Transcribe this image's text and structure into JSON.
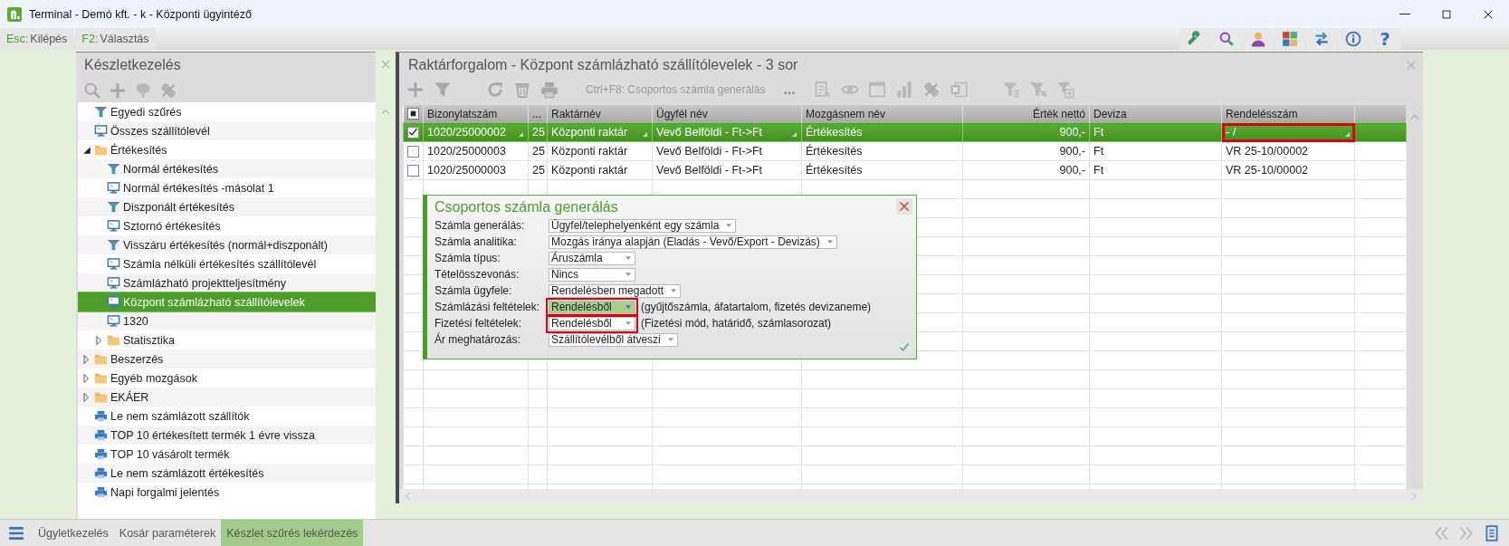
{
  "window": {
    "title": "Terminal - Demó kft. - k - Központi ügyintéző"
  },
  "shortcuts": [
    {
      "key": "Esc:",
      "label": "Kilépés"
    },
    {
      "key": "F2:",
      "label": "Választás"
    }
  ],
  "toolbar": {
    "help": "?"
  },
  "left_panel": {
    "title": "Készletkezelés",
    "items": [
      {
        "kind": "filter",
        "label": "Egyedi szűrés",
        "selected": false
      },
      {
        "kind": "screen",
        "label": "Összes szállítólevél",
        "selected": false
      },
      {
        "kind": "folder",
        "label": "Értékesítés",
        "selected": false,
        "expanded": true,
        "children": [
          {
            "kind": "filter",
            "label": "Normál értékesítés",
            "selected": false
          },
          {
            "kind": "screen",
            "label": "Normál értékesítés -másolat 1",
            "selected": false
          },
          {
            "kind": "filter",
            "label": "Diszponált értékesítés",
            "selected": false
          },
          {
            "kind": "screen",
            "label": "Sztornó értékesítés",
            "selected": false
          },
          {
            "kind": "filter",
            "label": "Visszáru értékesítés (normál+diszponált)",
            "selected": false
          },
          {
            "kind": "screen",
            "label": "Számla nélküli értékesítés szállítólevél",
            "selected": false
          },
          {
            "kind": "screen",
            "label": "Számlázható projektteljesítmény",
            "selected": false
          },
          {
            "kind": "screen",
            "label": "Központ számlázható szállítólevelek",
            "selected": true
          },
          {
            "kind": "screen",
            "label": "1320",
            "selected": false
          },
          {
            "kind": "folder",
            "label": "Statisztika",
            "selected": false,
            "expanded": false
          }
        ]
      },
      {
        "kind": "folder",
        "label": "Beszerzés",
        "selected": false,
        "expanded": false
      },
      {
        "kind": "folder",
        "label": "Egyéb mozgások",
        "selected": false,
        "expanded": false
      },
      {
        "kind": "folder",
        "label": "EKÁER",
        "selected": false,
        "expanded": false
      },
      {
        "kind": "print",
        "label": "Le nem számlázott szállítók",
        "selected": false
      },
      {
        "kind": "print",
        "label": "TOP 10 értékesített termék 1 évre vissza",
        "selected": false
      },
      {
        "kind": "print",
        "label": "TOP 10 vásárolt termék",
        "selected": false
      },
      {
        "kind": "print",
        "label": "Le nem számlázott értékesítés",
        "selected": false
      },
      {
        "kind": "print",
        "label": "Napi forgalmi jelentés",
        "selected": false
      }
    ]
  },
  "main_panel": {
    "title": "Raktárforgalom - Központ számlázható szállítólevelek - 3 sor",
    "toolbar_hint": "Ctrl+F8: Csoportos számla generálás",
    "more": "...",
    "table": {
      "select_all": {
        "partial": true
      },
      "columns": [
        {
          "label": "Bizonylatszám",
          "kind": "text"
        },
        {
          "label": "...",
          "kind": "text"
        },
        {
          "label": "Raktárnév",
          "kind": "text"
        },
        {
          "label": "Ügyfél név",
          "kind": "text"
        },
        {
          "label": "Mozgásnem név",
          "kind": "text"
        },
        {
          "label": "Érték nettó",
          "kind": "number"
        },
        {
          "label": "Deviza",
          "kind": "text"
        },
        {
          "label": "Rendelésszám",
          "kind": "text"
        }
      ],
      "rows": [
        {
          "checked": true,
          "selected": true,
          "cells": [
            {
              "text": "1020/25000002",
              "dropdown": true,
              "outlined": false
            },
            {
              "text": "25",
              "dropdown": false,
              "outlined": false
            },
            {
              "text": "Központi raktár",
              "dropdown": true,
              "outlined": false
            },
            {
              "text": "Vevő Belföldi - Ft->Ft",
              "dropdown": true,
              "outlined": false
            },
            {
              "text": "Értékesítés",
              "dropdown": false,
              "outlined": false
            },
            {
              "text": "900,-",
              "dropdown": false,
              "outlined": false
            },
            {
              "text": "Ft",
              "dropdown": false,
              "outlined": false
            },
            {
              "text": "-  /",
              "dropdown": true,
              "outlined": true
            }
          ]
        },
        {
          "checked": false,
          "selected": false,
          "cells": [
            {
              "text": "1020/25000003",
              "dropdown": false,
              "outlined": false
            },
            {
              "text": "25",
              "dropdown": false,
              "outlined": false
            },
            {
              "text": "Központi raktár",
              "dropdown": false,
              "outlined": false
            },
            {
              "text": "Vevő Belföldi - Ft->Ft",
              "dropdown": false,
              "outlined": false
            },
            {
              "text": "Értékesítés",
              "dropdown": false,
              "outlined": false
            },
            {
              "text": "900,-",
              "dropdown": false,
              "outlined": false
            },
            {
              "text": "Ft",
              "dropdown": false,
              "outlined": false
            },
            {
              "text": "VR 25-10/00002",
              "dropdown": false,
              "outlined": false
            }
          ]
        },
        {
          "checked": false,
          "selected": false,
          "cells": [
            {
              "text": "1020/25000003",
              "dropdown": false,
              "outlined": false
            },
            {
              "text": "25",
              "dropdown": false,
              "outlined": false
            },
            {
              "text": "Központi raktár",
              "dropdown": false,
              "outlined": false
            },
            {
              "text": "Vevő Belföldi - Ft->Ft",
              "dropdown": false,
              "outlined": false
            },
            {
              "text": "Értékesítés",
              "dropdown": false,
              "outlined": false
            },
            {
              "text": "900,-",
              "dropdown": false,
              "outlined": false
            },
            {
              "text": "Ft",
              "dropdown": false,
              "outlined": false
            },
            {
              "text": "VR 25-10/00002",
              "dropdown": false,
              "outlined": false
            }
          ]
        }
      ]
    }
  },
  "dialog": {
    "title": "Csoportos számla generálás",
    "fields": [
      {
        "label": "Számla generálás:",
        "value": "Ügyfel/telephelyenként egy számla",
        "focused": false,
        "outlined": false
      },
      {
        "label": "Számla analitika:",
        "value": "Mozgás iránya alapján (Eladás - Vevő/Export - Devizás)",
        "focused": false,
        "outlined": false
      },
      {
        "label": "Számla típus:",
        "value": "Áruszámla",
        "focused": false,
        "outlined": false
      },
      {
        "label": "Tételösszevonás:",
        "value": "Nincs",
        "focused": false,
        "outlined": false
      },
      {
        "label": "Számla ügyfele:",
        "value": "Rendelésben megadott",
        "focused": false,
        "outlined": false
      },
      {
        "label": "Számlázási feltételek:",
        "value": "Rendelésből",
        "hint": "(gyűjtőszámla, áfatartalom, fizetés devizaneme)",
        "focused": true,
        "outlined": true
      },
      {
        "label": "Fizetési feltételek:",
        "value": "Rendelésből",
        "hint": "(Fizetési mód, határidő, számlasorozat)",
        "focused": false,
        "outlined": true
      },
      {
        "label": "Ár meghatározás:",
        "value": "Szállítólevélből átveszi",
        "focused": false,
        "outlined": false
      }
    ]
  },
  "bottom_tabs": [
    {
      "label": "Ügyletkezelés",
      "selected": false
    },
    {
      "label": "Kosár paraméterek",
      "selected": false
    },
    {
      "label": "Készlet szűrés lekérdezés",
      "selected": true
    }
  ]
}
